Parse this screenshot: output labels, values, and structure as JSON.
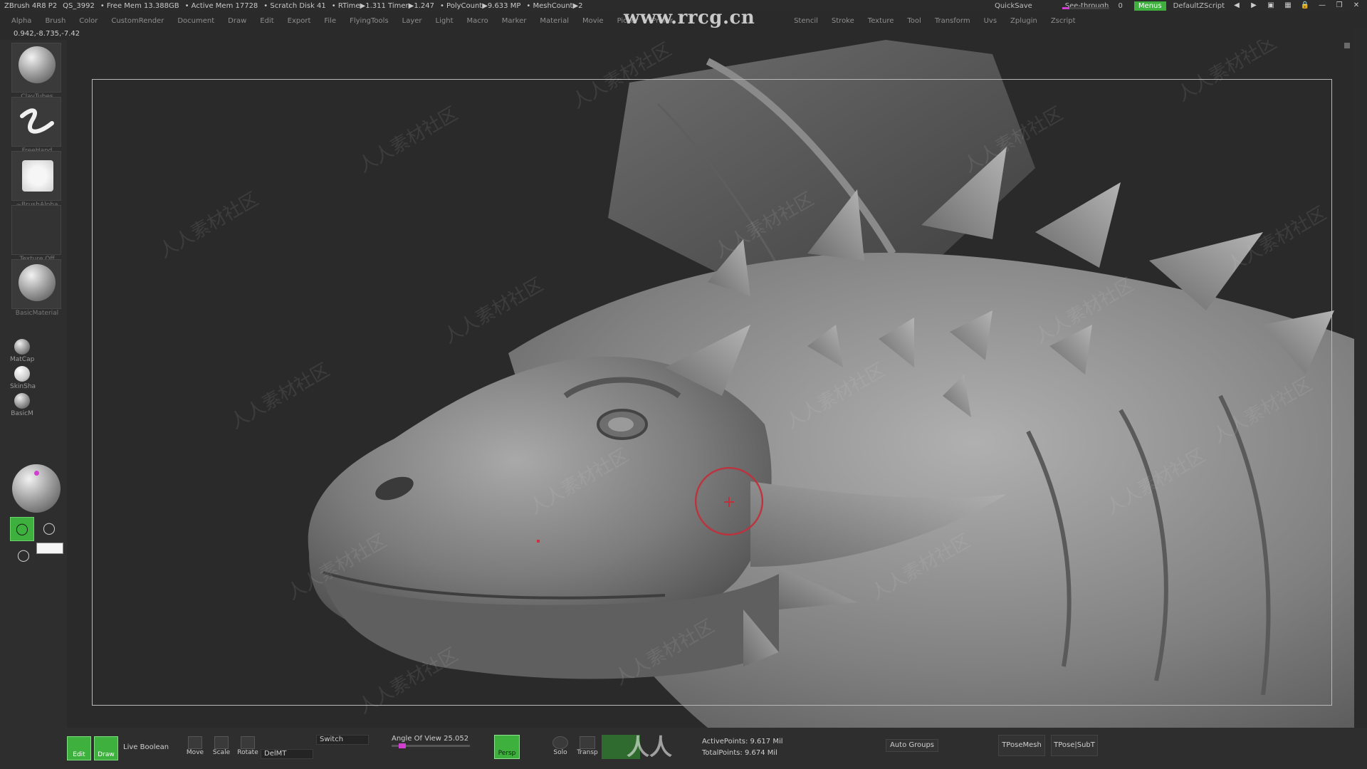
{
  "titlebar": {
    "app": "ZBrush 4R8 P2",
    "segments": [
      "QS_3992",
      "• Free Mem 13.388GB",
      "• Active Mem 17728",
      "• Scratch Disk 41",
      "• RTime▶1.311 Timer▶1.247",
      "• PolyCount▶9.633 MP",
      "• MeshCount▶2"
    ],
    "quicksave": "QuickSave",
    "seethrough": "See-through",
    "seethrough_value": "0",
    "seethrough_level": 0,
    "menus": "Menus",
    "script": "DefaultZScript"
  },
  "menu": {
    "items": [
      "Alpha",
      "Brush",
      "Color",
      "CustomRender",
      "Document",
      "Draw",
      "Edit",
      "Export",
      "File",
      "FlyingTools",
      "Layer",
      "Light",
      "Macro",
      "Marker",
      "Material",
      "Movie",
      "Picker",
      "Prefer",
      "Stencil",
      "Stroke",
      "Texture",
      "Tool",
      "Transform",
      "Uvs",
      "Zplugin",
      "Zscript"
    ]
  },
  "watermark_url": "www.rrcg.cn",
  "watermark_cjk": "人人素材社区",
  "coords": "0.942,-8.735,-7.42",
  "leftshelf": {
    "brush": "ClayTubes",
    "stroke": "FreeHand",
    "alpha": "~BrushAlpha",
    "texture": "Texture Off",
    "material": "BasicMaterial",
    "small_materials": [
      "MatCap",
      "SkinSha",
      "BasicM"
    ]
  },
  "bottom": {
    "edit": "Edit",
    "draw": "Draw",
    "live_boolean": "Live Boolean",
    "move": "Move",
    "scale": "Scale",
    "rotate": "Rotate",
    "switch": "Switch",
    "delmt": "DelMT",
    "angle_of_view": "Angle Of View 25.052",
    "persp": "Persp",
    "solo": "Solo",
    "transp": "Transp",
    "active_points": "ActivePoints: 9.617 Mil",
    "total_points": "TotalPoints: 9.674 Mil",
    "auto_groups": "Auto Groups",
    "tpose_mesh": "TPoseMesh",
    "tpose_subt": "TPose|SubT",
    "bottom_wm": "人人"
  },
  "colors": {
    "accent_green": "#3db03d",
    "accent_magenta": "#d040d0",
    "brush_ring": "#c0303a"
  }
}
